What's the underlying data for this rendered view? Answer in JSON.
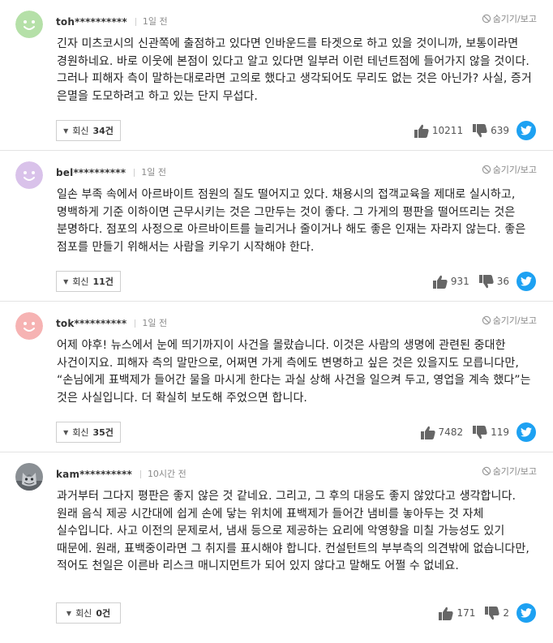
{
  "labels": {
    "hide": "숨기기/보고",
    "reply_prefix": "회신"
  },
  "colors": {
    "twitter": "#1da1f2",
    "separator": "#e4e4e4"
  },
  "comments": [
    {
      "user": "toh**********",
      "time": "1일 전",
      "avatar": "green-face",
      "text": "긴자 미츠코시의 신관쪽에 출점하고 있다면 인바운드를 타겟으로 하고 있을 것이니까, 보통이라면 경원하네요. 바로 이웃에 본점이 있다고 알고 있다면 일부러 이런 테넌트점에 들어가지 않을 것이다. 그러나 피해자 측이 말하는대로라면 고의로 했다고 생각되어도 무리도 없는 것은 아닌가? 사실, 증거 은멸을 도모하려고 하고 있는 단지 무섭다.",
      "replies": "34건",
      "likes": "10211",
      "dislikes": "639"
    },
    {
      "user": "bel**********",
      "time": "1일 전",
      "avatar": "purple-face",
      "text": "일손 부족 속에서 아르바이트 점원의 질도 떨어지고 있다. 채용시의 접객교육을 제대로 실시하고, 명백하게 기준 이하이면 근무시키는 것은 그만두는 것이 좋다. 그 가게의 평판을 떨어뜨리는 것은 분명하다. 점포의 사정으로 아르바이트를 늘리거나 줄이거나 해도 좋은 인재는 자라지 않는다. 좋은 점포를 만들기 위해서는 사람을 키우기 시작해야 한다.",
      "replies": "11건",
      "likes": "931",
      "dislikes": "36"
    },
    {
      "user": "tok**********",
      "time": "1일 전",
      "avatar": "pink-face",
      "text": "어제 야후! 뉴스에서 눈에 띄기까지이 사건을 몰랐습니다. 이것은 사람의 생명에 관련된 중대한 사건이지요. 피해자 측의 말만으로, 어쩌면 가게 측에도 변명하고 싶은 것은 있을지도 모릅니다만, “손님에게 표백제가 들어간 물을 마시게 한다는 과실 상해 사건을 일으켜 두고, 영업을 계속 했다”는 것은 사실입니다. 더 확실히 보도해 주었으면 합니다.",
      "replies": "35건",
      "likes": "7482",
      "dislikes": "119"
    },
    {
      "user": "kam**********",
      "time": "10시간 전",
      "avatar": "cat-photo",
      "text": "과거부터 그다지 평판은 좋지 않은 것 같네요. 그리고, 그 후의 대응도 좋지 않았다고 생각합니다. 원래 음식 제공 시간대에 쉽게 손에 닿는 위치에 표백제가 들어간 냄비를 놓아두는 것 자체 실수입니다. 사고 이전의 문제로서, 냄새 등으로 제공하는 요리에 악영향을 미칠 가능성도 있기 때문에. 원래, 표백중이라면 그 취지를 표시해야 합니다. 컨설턴트의 부부측의 의견밖에 없습니다만, 적어도 천일은 이른바 리스크 매니지먼트가 되어 있지 않다고 말해도 어쩔 수 없네요.",
      "replies": "0건",
      "likes": "171",
      "dislikes": "2"
    }
  ]
}
